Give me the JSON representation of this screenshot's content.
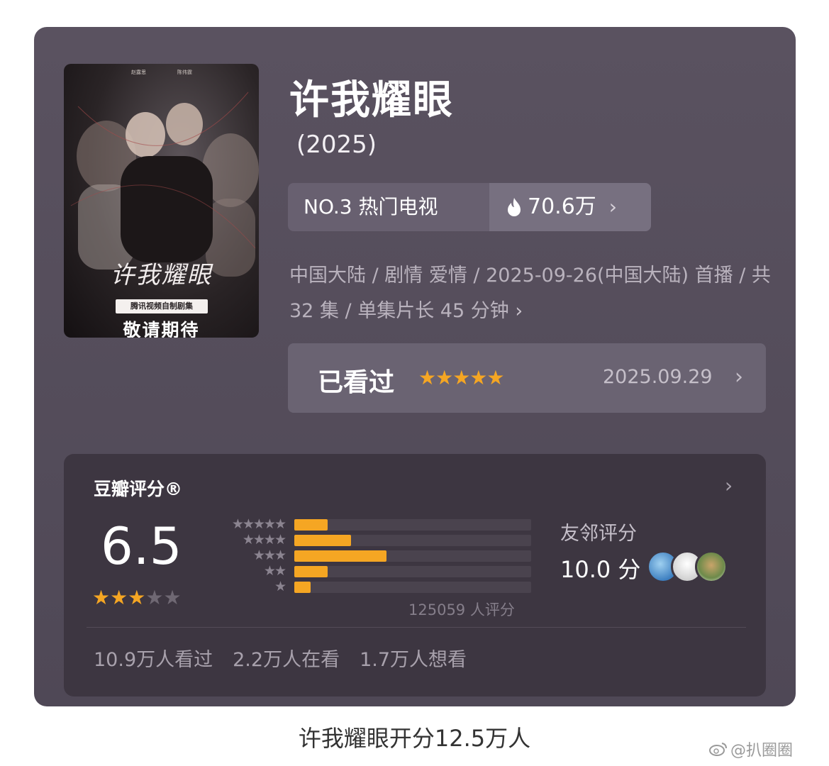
{
  "show": {
    "title": "许我耀眼",
    "year": "(2025)",
    "rank_label": "NO.3 热门电视",
    "heat": "70.6万",
    "meta": "中国大陆 / 剧情 爱情 / 2025-09-26(中国大陆) 首播 / 共 32 集 / 单集片长 45 分钟",
    "poster": {
      "title": "许我耀眼",
      "tag": "腾讯视频自制剧集",
      "cta": "敬请期待"
    }
  },
  "watched": {
    "label": "已看过",
    "user_rating_stars": 5,
    "stars_text": "★★★★★",
    "date": "2025.09.29"
  },
  "douban": {
    "title": "豆瓣评分®",
    "score": "6.5",
    "score_stars": 3,
    "distribution": [
      {
        "stars": 5,
        "label": "★★★★★",
        "fraction": 0.14
      },
      {
        "stars": 4,
        "label": "★★★★",
        "fraction": 0.24
      },
      {
        "stars": 3,
        "label": "★★★",
        "fraction": 0.39
      },
      {
        "stars": 2,
        "label": "★★",
        "fraction": 0.14
      },
      {
        "stars": 1,
        "label": "★",
        "fraction": 0.07
      }
    ],
    "raters": "125059 人评分",
    "friend_label": "友邻评分",
    "friend_score": "10.0 分",
    "stats": [
      "10.9万人看过",
      "2.2万人在看",
      "1.7万人想看"
    ]
  },
  "caption": "许我耀眼开分12.5万人",
  "watermark": "@扒圈圈",
  "colors": {
    "accent_star": "#f5a623",
    "card_bg": "#5a5260",
    "score_card_bg": "#3d3641"
  },
  "icons": [
    "flame-icon",
    "chevron-right-icon",
    "star-icon",
    "weibo-icon"
  ]
}
